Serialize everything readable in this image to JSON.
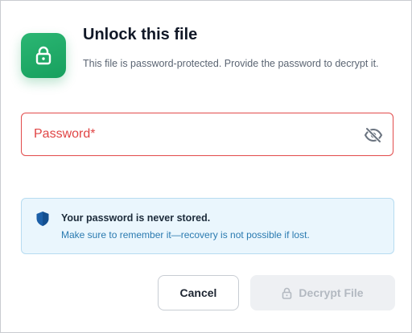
{
  "dialog": {
    "title": "Unlock this file",
    "subtitle": "This file is password-protected. Provide the password to decrypt it."
  },
  "password_field": {
    "label": "Password*",
    "value": ""
  },
  "notice": {
    "heading": "Your password is never stored.",
    "detail": "Make sure to remember it—recovery is not possible if lost."
  },
  "buttons": {
    "cancel": "Cancel",
    "decrypt": "Decrypt File"
  },
  "icons": {
    "badge": "lock-icon",
    "visibility": "eye-off-icon",
    "notice": "shield-icon",
    "decrypt": "lock-icon"
  },
  "colors": {
    "accent": "#1fa866",
    "error": "#e24b4b",
    "info": "#2a7ab0"
  }
}
